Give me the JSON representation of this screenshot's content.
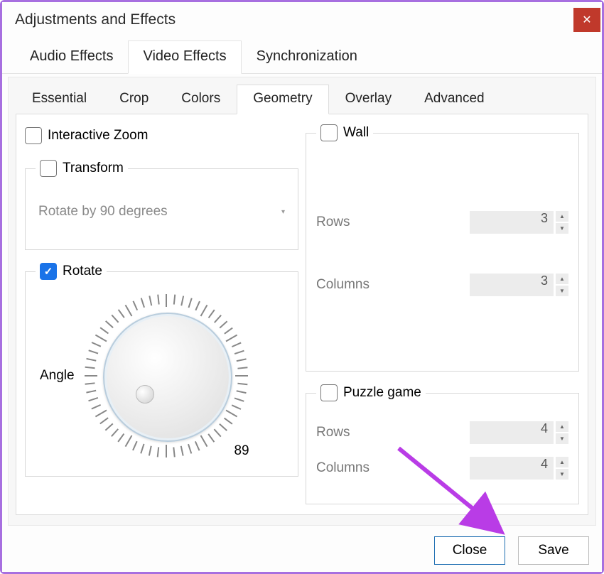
{
  "window": {
    "title": "Adjustments and Effects"
  },
  "main_tabs": {
    "audio": "Audio Effects",
    "video": "Video Effects",
    "sync": "Synchronization",
    "active": "video"
  },
  "sub_tabs": {
    "essential": "Essential",
    "crop": "Crop",
    "colors": "Colors",
    "geometry": "Geometry",
    "overlay": "Overlay",
    "advanced": "Advanced",
    "active": "geometry"
  },
  "geometry": {
    "interactive_zoom": {
      "label": "Interactive Zoom",
      "checked": false
    },
    "transform": {
      "label": "Transform",
      "checked": false,
      "dropdown": "Rotate by 90 degrees"
    },
    "rotate": {
      "label": "Rotate",
      "checked": true,
      "angle_label": "Angle",
      "angle_value": "89"
    },
    "wall": {
      "label": "Wall",
      "checked": false,
      "rows_label": "Rows",
      "rows_value": "3",
      "cols_label": "Columns",
      "cols_value": "3"
    },
    "puzzle": {
      "label": "Puzzle game",
      "checked": false,
      "rows_label": "Rows",
      "rows_value": "4",
      "cols_label": "Columns",
      "cols_value": "4"
    }
  },
  "footer": {
    "close": "Close",
    "save": "Save"
  }
}
